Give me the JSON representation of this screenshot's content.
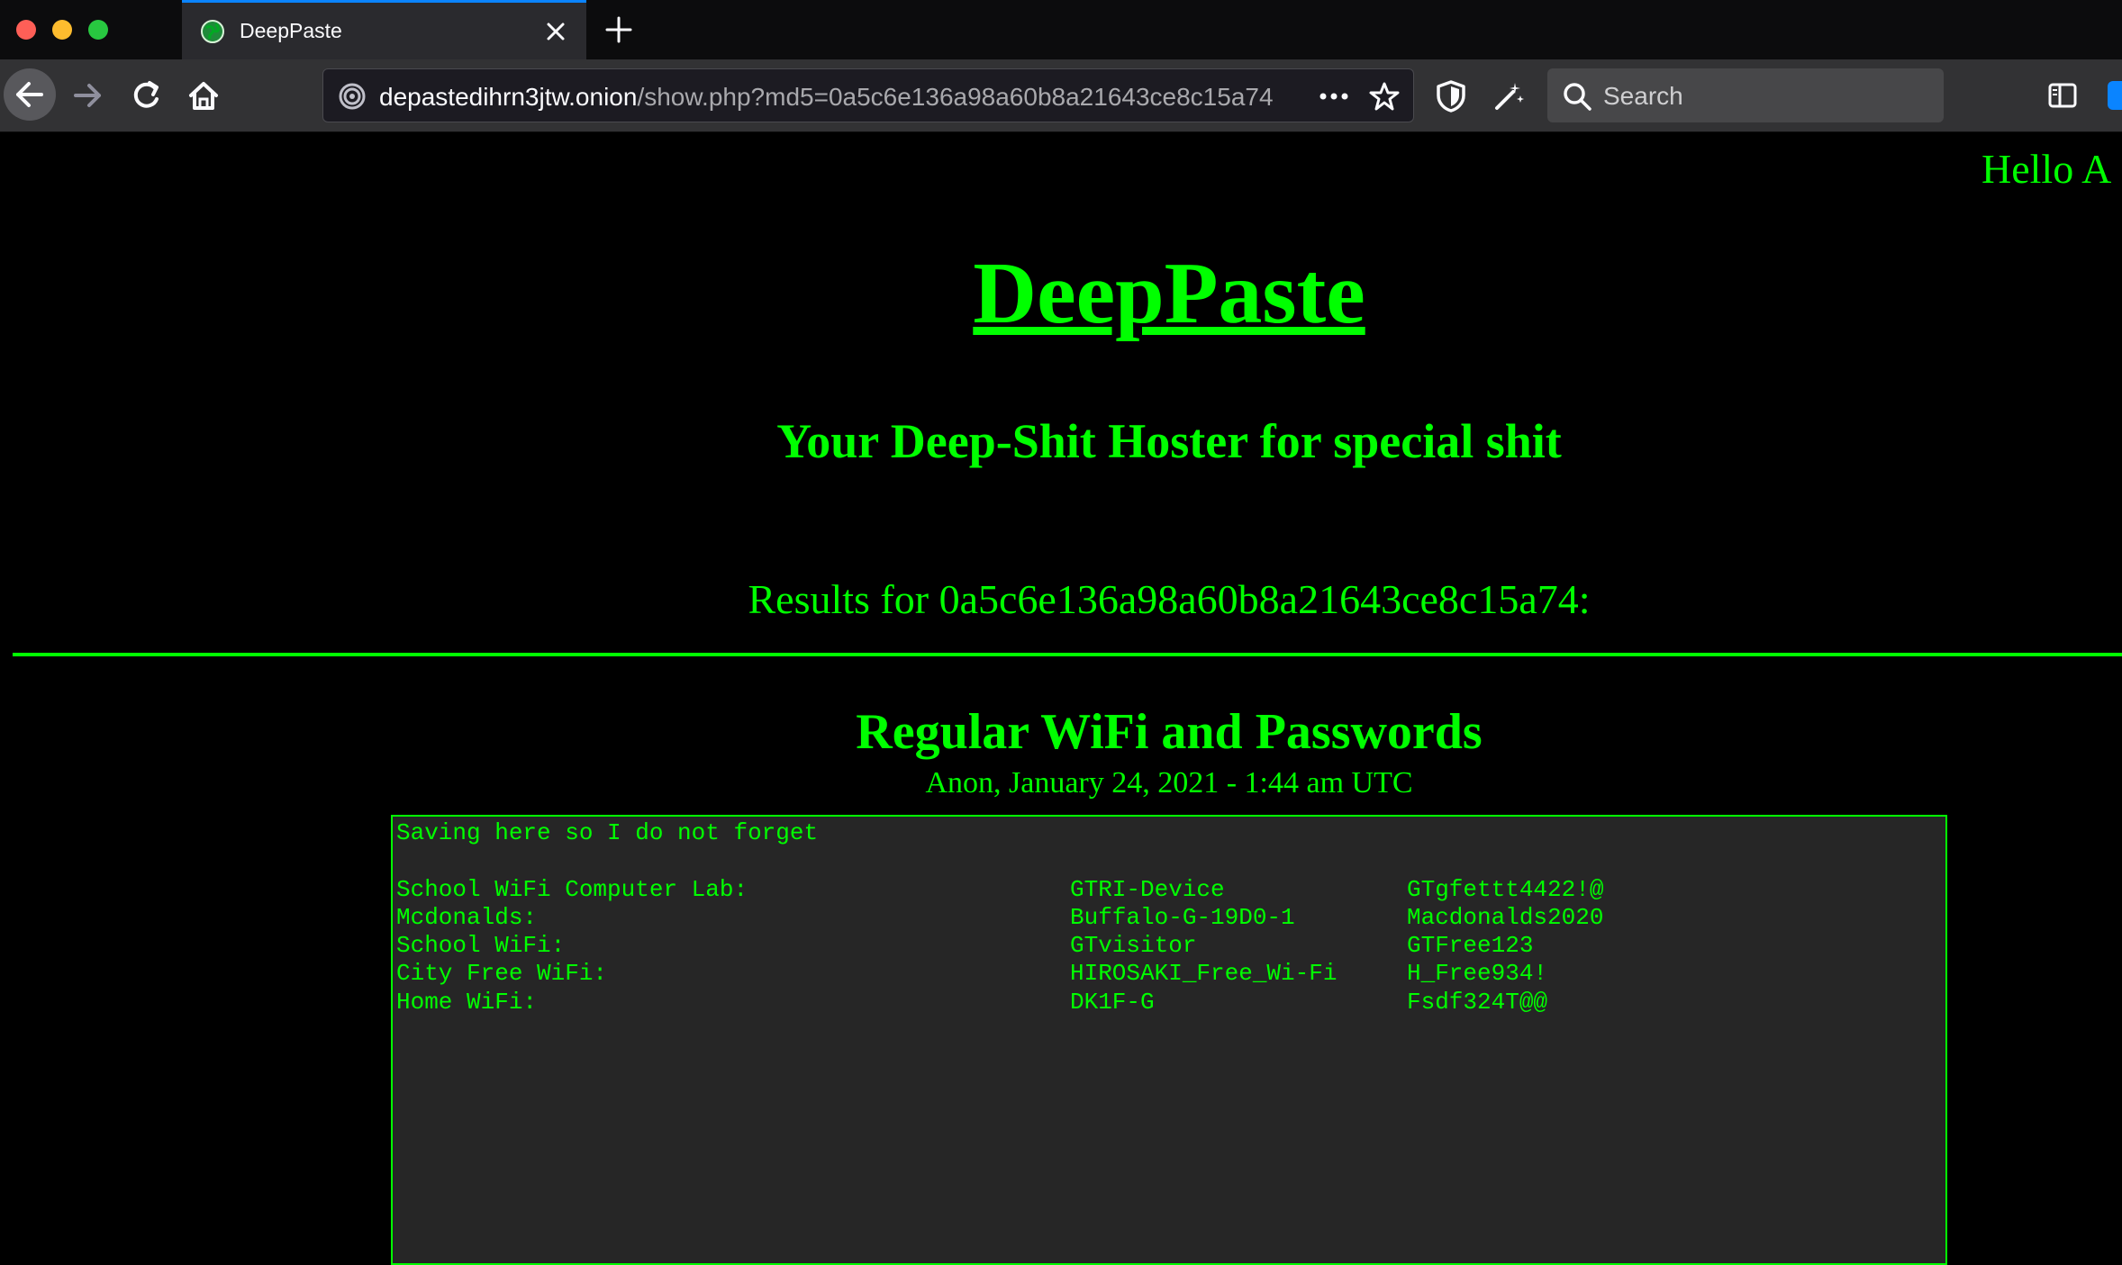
{
  "browser": {
    "tab_title": "DeepPaste",
    "url_host": "depastedihrn3jtw.onion",
    "url_path": "/show.php?md5=0a5c6e136a98a60b8a21643ce8c15a74",
    "search_placeholder": "Search"
  },
  "page": {
    "greeting": "Hello A",
    "site_title": "DeepPaste",
    "tagline": "Your Deep-Shit Hoster for special shit",
    "results_heading": "Results for 0a5c6e136a98a60b8a21643ce8c15a74:",
    "paste": {
      "title": "Regular WiFi and Passwords",
      "meta": "Anon, January 24, 2021 - 1:44 am UTC",
      "intro": "Saving here so I do not forget",
      "rows": [
        {
          "label": "School WiFi Computer Lab:",
          "network": "GTRI-Device",
          "password": "GTgfettt4422!@"
        },
        {
          "label": "Mcdonalds:",
          "network": "Buffalo-G-19D0-1",
          "password": "Macdonalds2020"
        },
        {
          "label": "School WiFi:",
          "network": "GTvisitor",
          "password": "GTFree123"
        },
        {
          "label": "City Free WiFi:",
          "network": "HIROSAKI_Free_Wi-Fi",
          "password": "H_Free934!"
        },
        {
          "label": "Home WiFi:",
          "network": "DK1F-G",
          "password": "Fsdf324T@@"
        }
      ]
    }
  },
  "colors": {
    "text_green": "#00ff00",
    "page_background": "#000000",
    "paste_background": "#262626",
    "tab_accent": "#0a84ff"
  }
}
